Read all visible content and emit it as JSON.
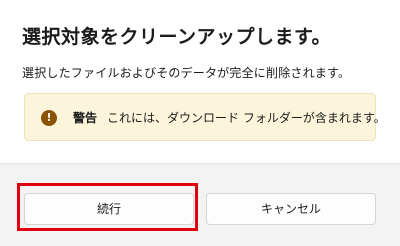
{
  "dialog": {
    "title": "選択対象をクリーンアップします。",
    "message": "選択したファイルおよびそのデータが完全に削除されます。",
    "warning": {
      "icon": "exclamation-icon",
      "title": "警告",
      "text": "これには、ダウンロード フォルダーが含まれます。",
      "background": "#fcf4db",
      "icon_color": "#8a5300"
    },
    "buttons": {
      "continue_label": "続行",
      "cancel_label": "キャンセル"
    },
    "highlight_color": "#e1000f"
  }
}
